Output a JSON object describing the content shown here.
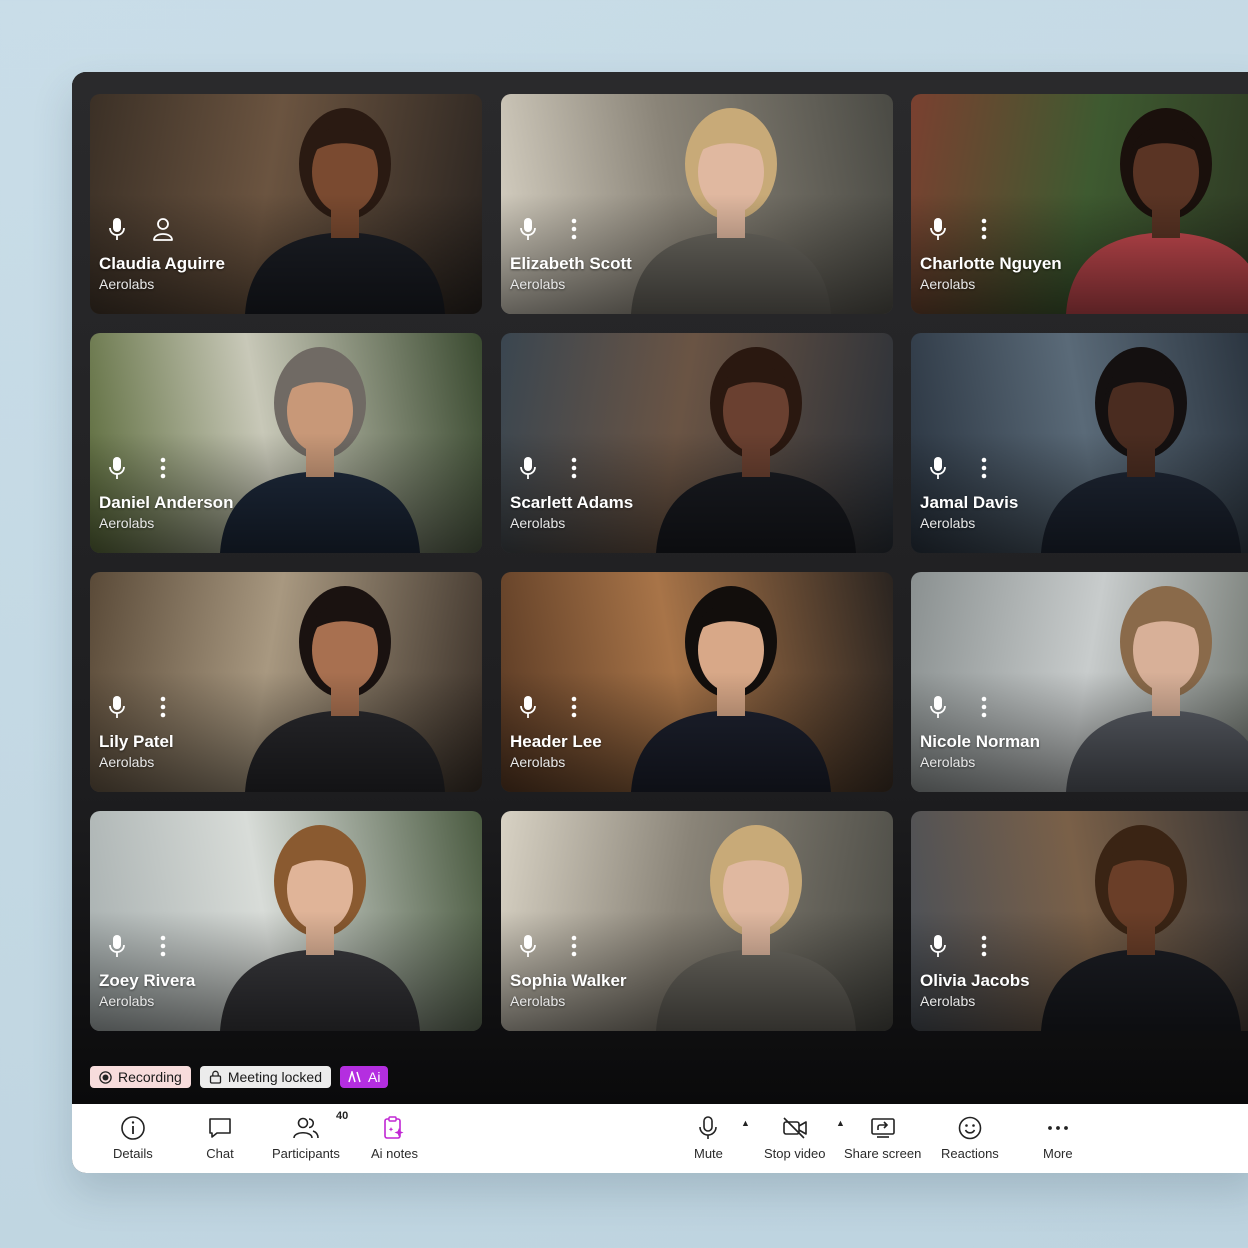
{
  "participants": [
    {
      "name": "Claudia Aguirre",
      "org": "Aerolabs",
      "second_icon": "person-icon",
      "bg": [
        "#3b3026",
        "#6b5440",
        "#2a2420"
      ],
      "skin": "#7a4a30",
      "hair": "#2a1a12",
      "suit": "#1c1f26"
    },
    {
      "name": "Elizabeth Scott",
      "org": "Aerolabs",
      "second_icon": "more-options-icon",
      "bg": [
        "#d8d2c4",
        "#8a8478",
        "#4a4a44"
      ],
      "skin": "#e0b8a0",
      "hair": "#c8aa78",
      "suit": "#6d6a62"
    },
    {
      "name": "Charlotte Nguyen",
      "org": "Aerolabs",
      "second_icon": "more-options-icon",
      "bg": [
        "#7a4030",
        "#3e5a30",
        "#2a3020"
      ],
      "skin": "#5a3424",
      "hair": "#1a100c",
      "suit": "#c84a50"
    },
    {
      "name": "Daniel Anderson",
      "org": "Aerolabs",
      "second_icon": "more-options-icon",
      "bg": [
        "#5a6a3a",
        "#c8c8b8",
        "#3a4a30"
      ],
      "skin": "#c89878",
      "hair": "#706a64",
      "suit": "#1e2a3c"
    },
    {
      "name": "Scarlett Adams",
      "org": "Aerolabs",
      "second_icon": "more-options-icon",
      "bg": [
        "#3a4650",
        "#6a5444",
        "#2a3038"
      ],
      "skin": "#6a4030",
      "hair": "#2a1810",
      "suit": "#1a1c22"
    },
    {
      "name": "Jamal Davis",
      "org": "Aerolabs",
      "second_icon": "more-options-icon",
      "bg": [
        "#2a3440",
        "#5a6a78",
        "#1e2630"
      ],
      "skin": "#4a2c20",
      "hair": "#141010",
      "suit": "#1e2634"
    },
    {
      "name": "Lily Patel",
      "org": "Aerolabs",
      "second_icon": "more-options-icon",
      "bg": [
        "#5a4a38",
        "#a89880",
        "#3a3028"
      ],
      "skin": "#a87050",
      "hair": "#1a1210",
      "suit": "#2a2a2e"
    },
    {
      "name": "Header Lee",
      "org": "Aerolabs",
      "second_icon": "more-options-icon",
      "bg": [
        "#5a3a24",
        "#a87448",
        "#2a2420"
      ],
      "skin": "#d8a888",
      "hair": "#120e0c",
      "suit": "#1e2230"
    },
    {
      "name": "Nicole Norman",
      "org": "Aerolabs",
      "second_icon": "more-options-icon",
      "bg": [
        "#8a9090",
        "#c8cccc",
        "#5a6058"
      ],
      "skin": "#d8b098",
      "hair": "#8a6a4a",
      "suit": "#5a5e66"
    },
    {
      "name": "Zoey Rivera",
      "org": "Aerolabs",
      "second_icon": "more-options-icon",
      "bg": [
        "#a8b0b0",
        "#d8dcd8",
        "#4a5a40"
      ],
      "skin": "#e0b498",
      "hair": "#8a5a30",
      "suit": "#3a3a3e"
    },
    {
      "name": "Sophia Walker",
      "org": "Aerolabs",
      "second_icon": "more-options-icon",
      "bg": [
        "#d8d2c4",
        "#8a8478",
        "#4a4a44"
      ],
      "skin": "#e0b8a0",
      "hair": "#c8aa78",
      "suit": "#6d6a62"
    },
    {
      "name": "Olivia Jacobs",
      "org": "Aerolabs",
      "second_icon": "more-options-icon",
      "bg": [
        "#4a5058",
        "#7a6048",
        "#2a2c30"
      ],
      "skin": "#6a3e28",
      "hair": "#3a2414",
      "suit": "#1c1e24"
    }
  ],
  "status_badges": {
    "recording": "Recording",
    "meeting_locked": "Meeting locked",
    "ai": "Ai"
  },
  "toolbar": {
    "details": "Details",
    "chat": "Chat",
    "participants": "Participants",
    "participants_count": "40",
    "ai_notes": "Ai notes",
    "mute": "Mute",
    "stop_video": "Stop video",
    "share_screen": "Share screen",
    "reactions": "Reactions",
    "more": "More"
  },
  "colors": {
    "ai_accent": "#b42ee0",
    "ai_notes_icon": "#c026d3",
    "recording_bg": "#f7dcdc",
    "window_bg": "#0b0b0c"
  }
}
